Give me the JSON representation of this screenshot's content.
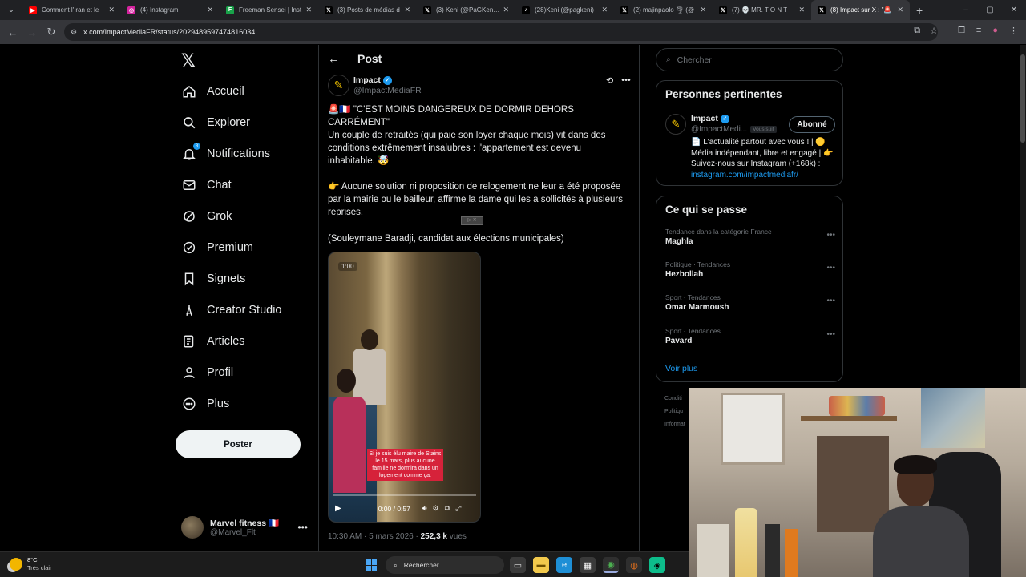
{
  "browser": {
    "tabs": [
      {
        "title": "Comment l'Iran et le",
        "icon": "youtube-icon",
        "color": "#ff0000",
        "glyph": "▶"
      },
      {
        "title": "(4) Instagram",
        "icon": "instagram-icon",
        "color": "#d6249f",
        "glyph": "◎"
      },
      {
        "title": "Freeman Sensei | Inst",
        "icon": "freeman-icon",
        "color": "#19a34a",
        "glyph": "F"
      },
      {
        "title": "(3) Posts de médias d",
        "icon": "x-icon",
        "color": "#000000",
        "glyph": "𝕏"
      },
      {
        "title": "(3) Keni (@PaGKeni) /",
        "icon": "x-icon",
        "color": "#000000",
        "glyph": "𝕏"
      },
      {
        "title": "(28)Keni (@pagkeni)",
        "icon": "tiktok-icon",
        "color": "#000000",
        "glyph": "♪"
      },
      {
        "title": "(2) majinpaolo 🌪 (@",
        "icon": "x-icon",
        "color": "#000000",
        "glyph": "𝕏"
      },
      {
        "title": "(7) 💀 MR. T O N T",
        "icon": "x-icon",
        "color": "#000000",
        "glyph": "𝕏"
      },
      {
        "title": "(8) Impact sur X : \"🚨",
        "icon": "x-icon",
        "color": "#000000",
        "glyph": "𝕏",
        "active": true
      }
    ],
    "url": "x.com/ImpactMediaFR/status/2029489597474816034"
  },
  "sidebar": {
    "items": [
      {
        "label": "Accueil",
        "icon": "home-icon"
      },
      {
        "label": "Explorer",
        "icon": "search-icon"
      },
      {
        "label": "Notifications",
        "icon": "bell-icon",
        "badge": "8"
      },
      {
        "label": "Chat",
        "icon": "mail-icon"
      },
      {
        "label": "Grok",
        "icon": "grok-icon"
      },
      {
        "label": "Premium",
        "icon": "premium-icon"
      },
      {
        "label": "Signets",
        "icon": "bookmark-icon"
      },
      {
        "label": "Creator Studio",
        "icon": "creator-studio-icon"
      },
      {
        "label": "Articles",
        "icon": "articles-icon"
      },
      {
        "label": "Profil",
        "icon": "profile-icon"
      },
      {
        "label": "Plus",
        "icon": "more-icon"
      }
    ],
    "post_button": "Poster",
    "account": {
      "name": "Marvel fitness 🇫🇷",
      "handle": "@Marvel_Flt"
    }
  },
  "post": {
    "header_title": "Post",
    "author_name": "Impact",
    "author_handle": "@ImpactMediaFR",
    "headline": "🚨🇫🇷 \"C'EST MOINS DANGEREUX DE DORMIR DEHORS CARRÉMENT\"",
    "para1": "Un couple de retraités (qui paie son loyer chaque mois) vit dans des conditions extrêmement insalubres : l'appartement est devenu inhabitable. 🤯",
    "para2": "👉 Aucune solution ni proposition de relogement ne leur a été proposée par la mairie ou le bailleur, affirme la dame qui les a sollicités à plusieurs reprises.",
    "para3": "(Souleymane Baradji, candidat aux élections municipales)",
    "video": {
      "badge": "1:00",
      "caption": "Si je suis élu maire de Stains le 15 mars, plus aucune famille ne dormira dans un logement comme ça.",
      "time": "0:00 / 0:57"
    },
    "meta_date": "10:30 AM · 5 mars 2026 · ",
    "meta_views_value": "252,3 k",
    "meta_views_label": " vues"
  },
  "right": {
    "search_placeholder": "Chercher",
    "relevant": {
      "title": "Personnes pertinentes",
      "name": "Impact",
      "handle": "@ImpactMedi...",
      "follows_you": "Vous suit",
      "follow_button": "Abonné",
      "bio": "📄 L'actualité partout avec vous ! | 🟡 Média indépendant, libre et engagé | 👉 Suivez-nous sur Instagram (+168k) : ",
      "bio_link": "instagram.com/impactmediafr/"
    },
    "trends": {
      "title": "Ce qui se passe",
      "items": [
        {
          "context": "Tendance dans la catégorie France",
          "name": "Maghla"
        },
        {
          "context": "Politique · Tendances",
          "name": "Hezbollah"
        },
        {
          "context": "Sport · Tendances",
          "name": "Omar Marmoush"
        },
        {
          "context": "Sport · Tendances",
          "name": "Pavard"
        }
      ],
      "see_more": "Voir plus"
    },
    "footer": [
      "Conditi",
      "Politiqu",
      "Informat"
    ]
  },
  "taskbar": {
    "temp": "8°C",
    "weather": "Très clair",
    "search": "Rechercher"
  }
}
